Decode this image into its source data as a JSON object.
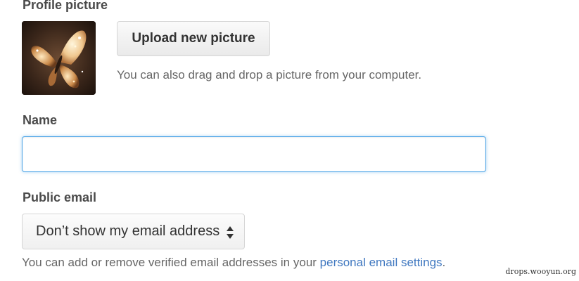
{
  "profile": {
    "section_title": "Profile picture",
    "upload_button_label": "Upload new picture",
    "drag_hint": "You can also drag and drop a picture from your computer."
  },
  "name": {
    "section_title": "Name",
    "value": "",
    "placeholder": ""
  },
  "public_email": {
    "section_title": "Public email",
    "selected_option": "Don’t show my email address",
    "help_text_prefix": "You can add or remove verified email addresses in your ",
    "help_link_text": "personal email settings",
    "help_text_suffix": "."
  },
  "watermark": "drops.wooyun.org",
  "colors": {
    "link": "#4078c0",
    "focus_border": "#51a7e8",
    "avatar_bg": "#2a1a12"
  },
  "icons": {
    "select_arrows": "up-down-caret-icon"
  }
}
